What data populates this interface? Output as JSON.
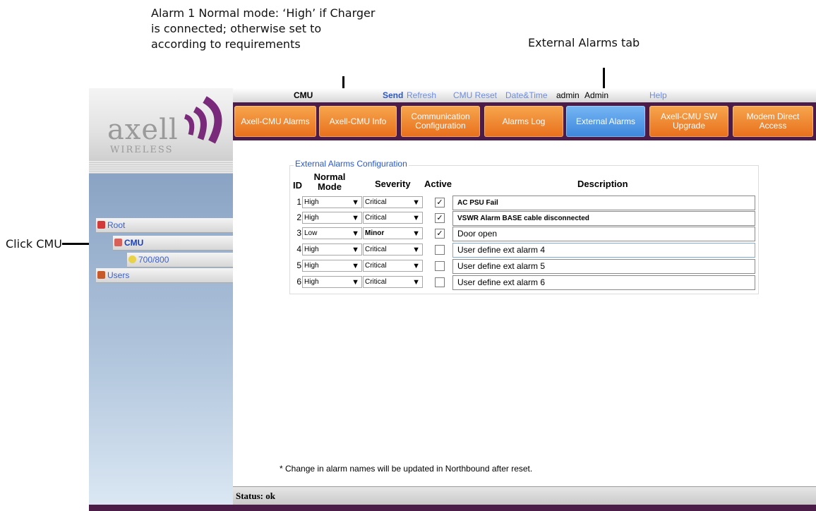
{
  "annotations": {
    "alarm1_note_lines": [
      "Alarm 1 Normal mode: ‘High’ if Charger",
      "is connected; otherwise set to",
      "according to requirements"
    ],
    "ext_alarms_tab_note": "External Alarms tab",
    "click_cmu_note": "Click CMU"
  },
  "logo": {
    "brand": "axell",
    "sub": "WIRELESS"
  },
  "tree": {
    "items": [
      {
        "label": "Root",
        "icon": "root-icon"
      },
      {
        "label": "CMU",
        "icon": "cmu-icon"
      },
      {
        "label": "700/800",
        "icon": "band-icon"
      },
      {
        "label": "Users",
        "icon": "users-icon"
      }
    ]
  },
  "topbar": {
    "node": "CMU",
    "send": "Send",
    "refresh": "Refresh",
    "cmu_reset": "CMU Reset",
    "date_time": "Date&Time",
    "user": "admin",
    "role": "Admin",
    "help": "Help"
  },
  "tabs": [
    {
      "label": "Axell-CMU Alarms"
    },
    {
      "label": "Axell-CMU Info"
    },
    {
      "label": "Communication Configuration"
    },
    {
      "label": "Alarms Log"
    },
    {
      "label": "External Alarms",
      "active": true
    },
    {
      "label": "Axell-CMU SW Upgrade"
    },
    {
      "label": "Modem Direct Access"
    }
  ],
  "form": {
    "legend": "External Alarms Configuration",
    "headers": {
      "id": "ID",
      "normal_mode": "Normal Mode",
      "severity": "Severity",
      "active": "Active",
      "description": "Description"
    },
    "rows": [
      {
        "id": "1",
        "mode": "High",
        "severity": "Critical",
        "active": true,
        "description": "AC PSU Fail"
      },
      {
        "id": "2",
        "mode": "High",
        "severity": "Critical",
        "active": true,
        "description": "VSWR Alarm BASE cable disconnected"
      },
      {
        "id": "3",
        "mode": "Low",
        "severity": "Minor",
        "active": true,
        "description": "Door open"
      },
      {
        "id": "4",
        "mode": "High",
        "severity": "Critical",
        "active": false,
        "description": "User define ext alarm 4"
      },
      {
        "id": "5",
        "mode": "High",
        "severity": "Critical",
        "active": false,
        "description": "User define ext alarm 5"
      },
      {
        "id": "6",
        "mode": "High",
        "severity": "Critical",
        "active": false,
        "description": "User define ext alarm 6"
      }
    ],
    "footnote": "* Change in alarm names will be updated in Northbound after reset."
  },
  "status": {
    "text": "Status: ok"
  },
  "colors": {
    "tab_orange": "#e96f1c",
    "tab_active_blue": "#3d86dc",
    "frame_purple": "#4b1c47",
    "link_blue": "#3a5fcd",
    "brand_purple": "#7a2a7a"
  }
}
